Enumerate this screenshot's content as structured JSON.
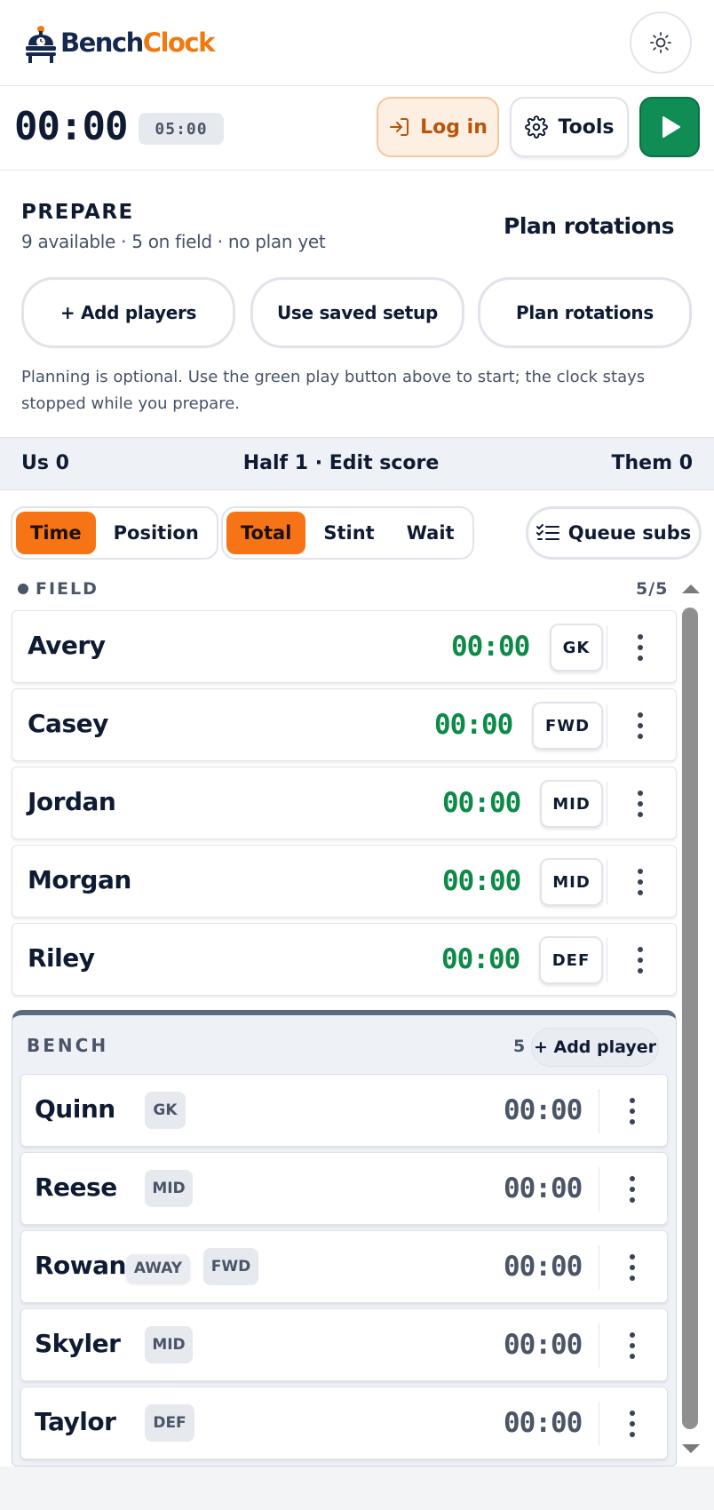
{
  "brand": {
    "bench": "Bench",
    "clock": "Clock"
  },
  "clock": {
    "main": "00:00",
    "limit": "05:00"
  },
  "actions": {
    "login": "Log in",
    "tools": "Tools"
  },
  "prepare": {
    "title": "PREPARE",
    "summary": "9 available · 5 on field · no plan yet",
    "plan_link": "Plan rotations",
    "buttons": [
      "+ Add players",
      "Use saved setup",
      "Plan rotations"
    ],
    "note": "Planning is optional. Use the green play button above to start; the clock stays stopped while you prepare."
  },
  "score": {
    "us": "Us 0",
    "middle": "Half 1 · Edit score",
    "them": "Them 0"
  },
  "view_toggle": {
    "options": [
      "Time",
      "Position"
    ],
    "selected": "Time"
  },
  "metric_toggle": {
    "options": [
      "Total",
      "Stint",
      "Wait"
    ],
    "selected": "Total"
  },
  "queue_subs": "Queue subs",
  "field": {
    "title": "FIELD",
    "count": "5/5",
    "players": [
      {
        "name": "Avery",
        "time": "00:00",
        "position": "GK"
      },
      {
        "name": "Casey",
        "time": "00:00",
        "position": "FWD"
      },
      {
        "name": "Jordan",
        "time": "00:00",
        "position": "MID"
      },
      {
        "name": "Morgan",
        "time": "00:00",
        "position": "MID"
      },
      {
        "name": "Riley",
        "time": "00:00",
        "position": "DEF"
      }
    ]
  },
  "bench": {
    "title": "BENCH",
    "count": "5",
    "add_label": "+ Add player",
    "players": [
      {
        "name": "Quinn",
        "position": "GK",
        "time": "00:00"
      },
      {
        "name": "Reese",
        "position": "MID",
        "time": "00:00"
      },
      {
        "name": "Rowan",
        "status": "AWAY",
        "position": "FWD",
        "time": "00:00"
      },
      {
        "name": "Skyler",
        "position": "MID",
        "time": "00:00"
      },
      {
        "name": "Taylor",
        "position": "DEF",
        "time": "00:00"
      }
    ]
  },
  "colors": {
    "accent_orange": "#f77416",
    "play_green": "#0f8d55",
    "field_time_green": "#0d8a48",
    "navy_text": "#0f1b33"
  },
  "icons": [
    "logo-mascot-icon",
    "sun-icon",
    "login-icon",
    "gear-icon",
    "play-icon",
    "queue-list-icon",
    "kebab-menu-icon",
    "scroll-up-icon",
    "scroll-down-icon"
  ]
}
